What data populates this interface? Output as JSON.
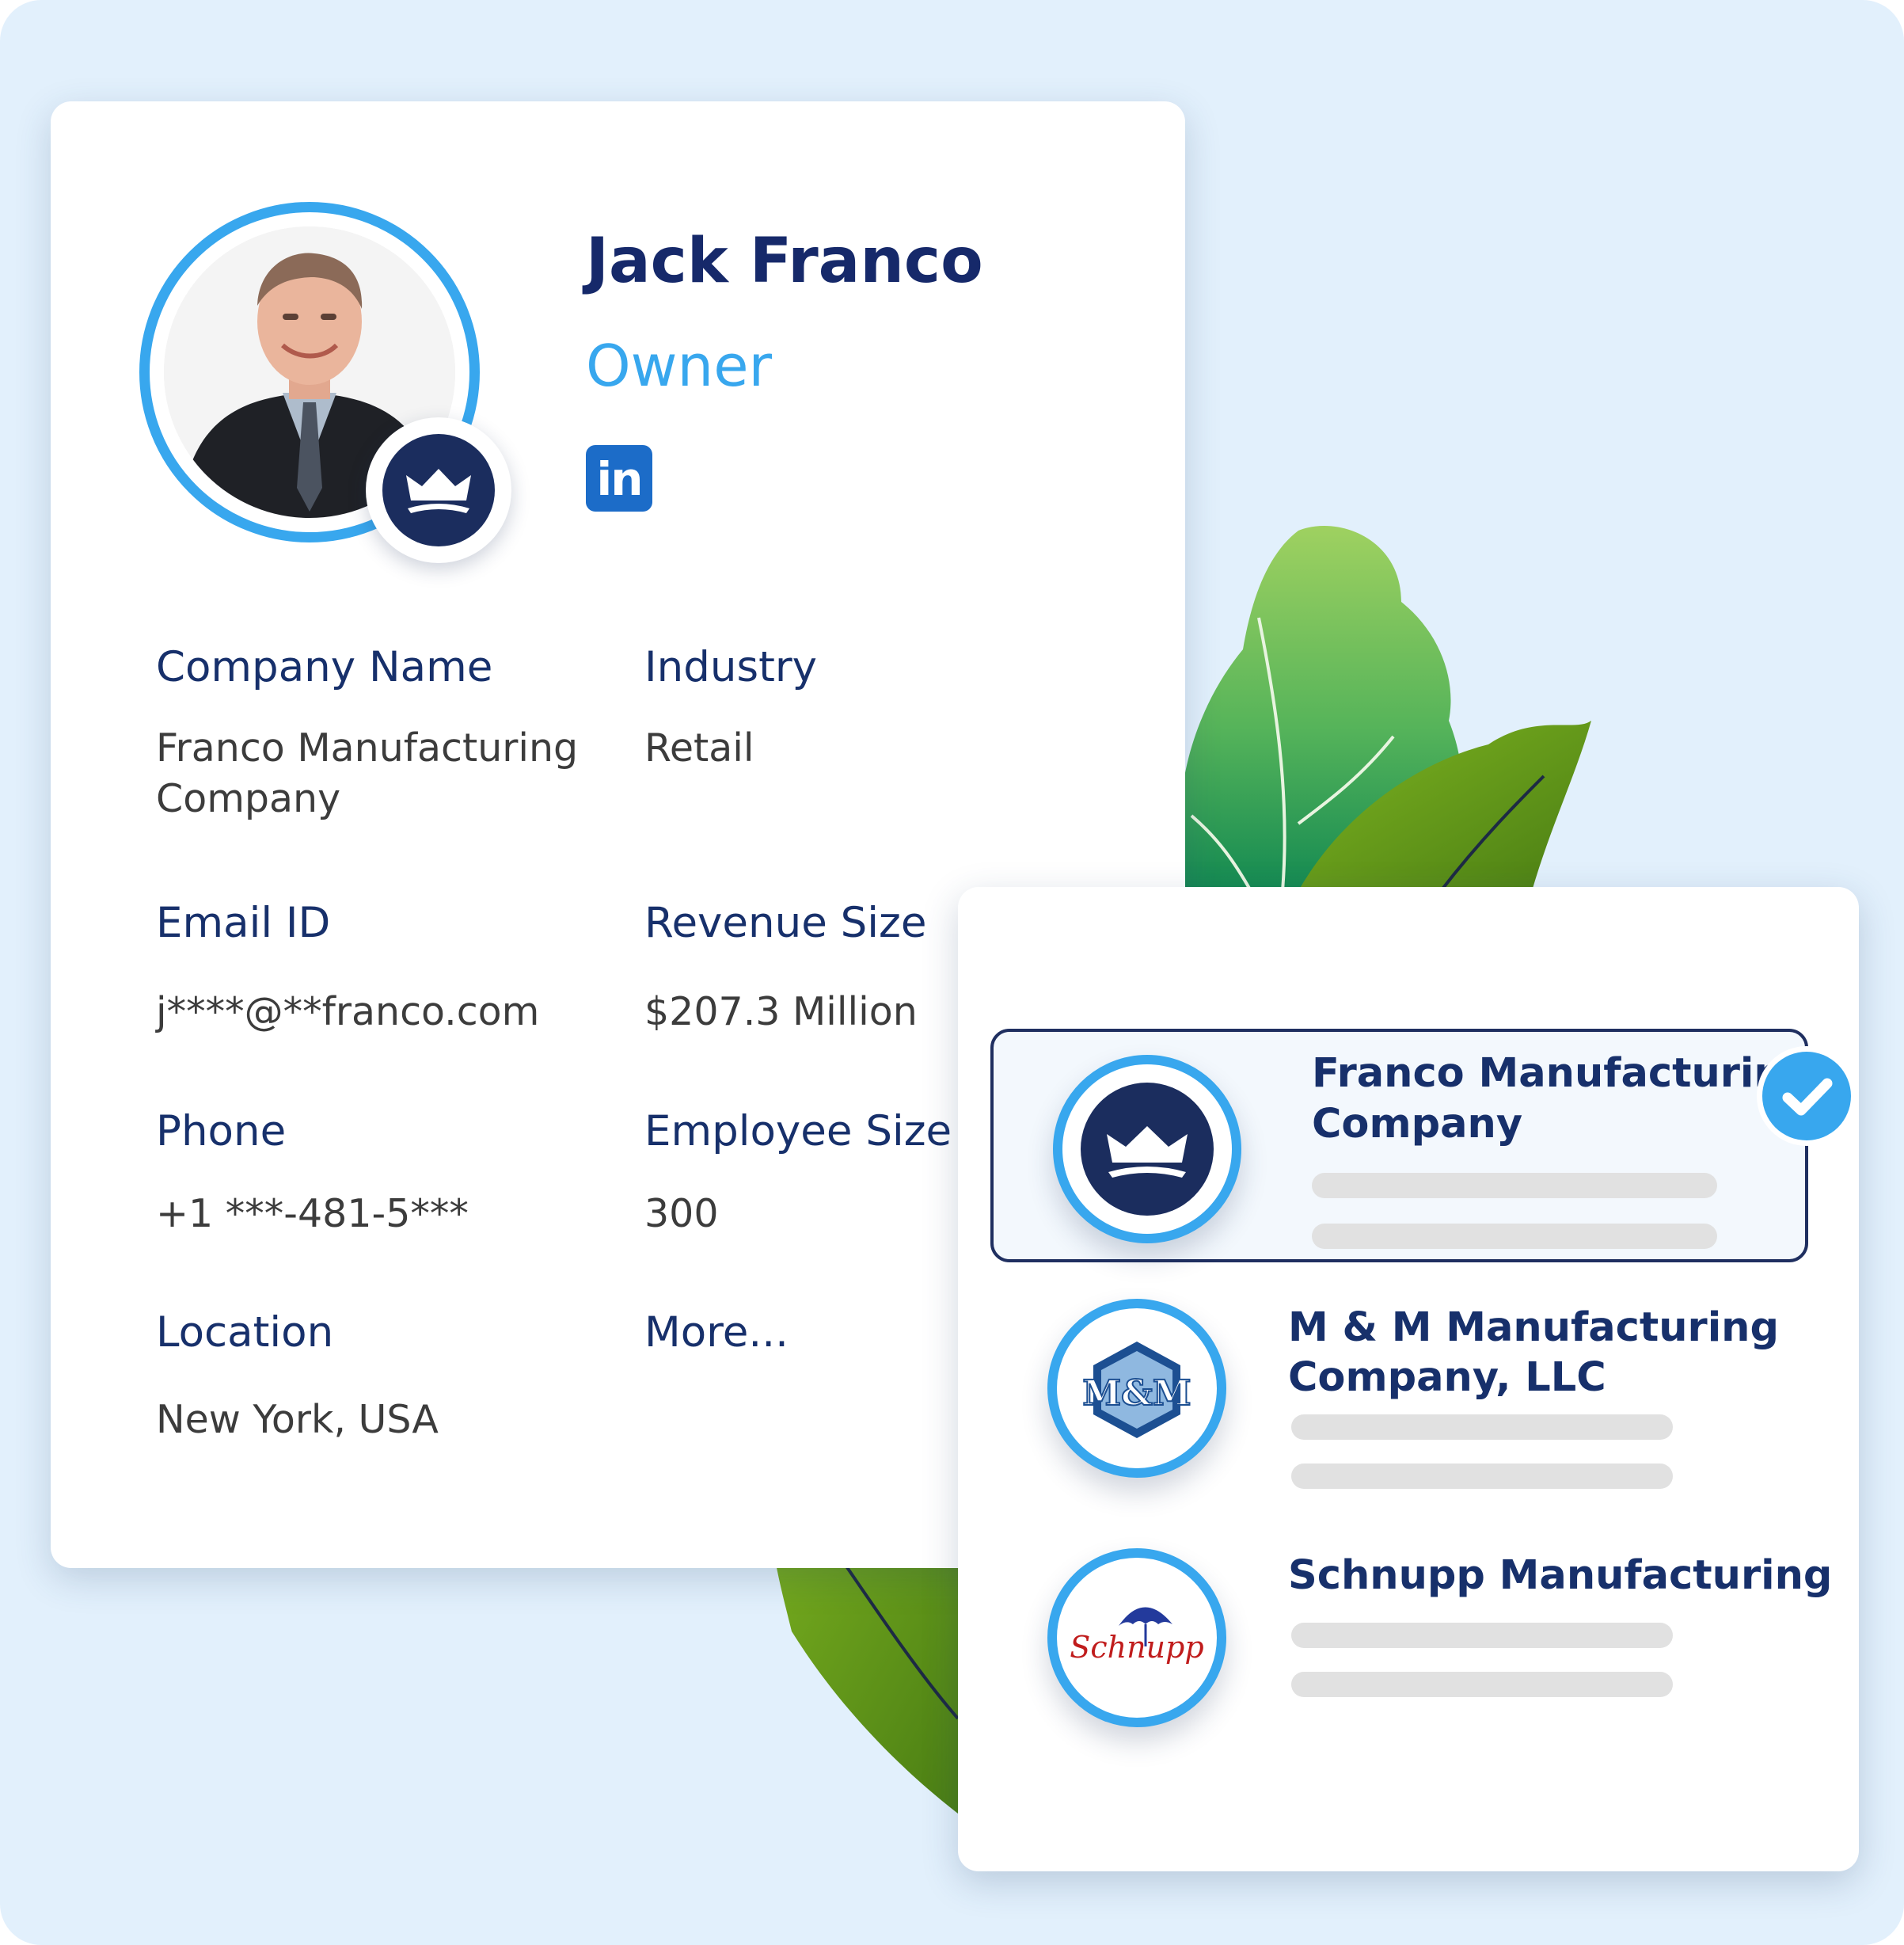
{
  "profile": {
    "name": "Jack Franco",
    "role": "Owner",
    "social_icon": "linkedin-icon",
    "social_text": "in",
    "badge_icon": "crown-icon"
  },
  "fields": {
    "company_name": {
      "label": "Company Name",
      "value_line1": "Franco Manufacturing",
      "value_line2": "Company"
    },
    "industry": {
      "label": "Industry",
      "value": "Retail"
    },
    "email": {
      "label": "Email ID",
      "value": "j****@**franco.com"
    },
    "revenue": {
      "label": "Revenue Size",
      "value": "$207.3 Million"
    },
    "phone": {
      "label": "Phone",
      "value": "+1 ***-481-5***"
    },
    "employees": {
      "label": "Employee Size",
      "value": "300"
    },
    "location": {
      "label": "Location",
      "value": "New York, USA"
    },
    "more": {
      "label": "More..."
    }
  },
  "companies": [
    {
      "line1": "Franco Manufacturing",
      "line2": "Company",
      "selected": true,
      "logo_icon": "crown-logo-icon"
    },
    {
      "line1": "M & M Manufacturing",
      "line2": "Company, LLC",
      "selected": false,
      "logo_icon": "mm-logo-icon",
      "logo_text": "M&M"
    },
    {
      "line1": "Schnupp Manufacturing",
      "line2": "",
      "selected": false,
      "logo_icon": "schnupp-logo-icon",
      "logo_text": "Schnupp"
    }
  ],
  "colors": {
    "background": "#e2f0fc",
    "primary_navy": "#16296a",
    "accent_blue": "#38a7ee",
    "linkedin_blue": "#1c6cc8",
    "leaf_green": "#6aa321"
  }
}
